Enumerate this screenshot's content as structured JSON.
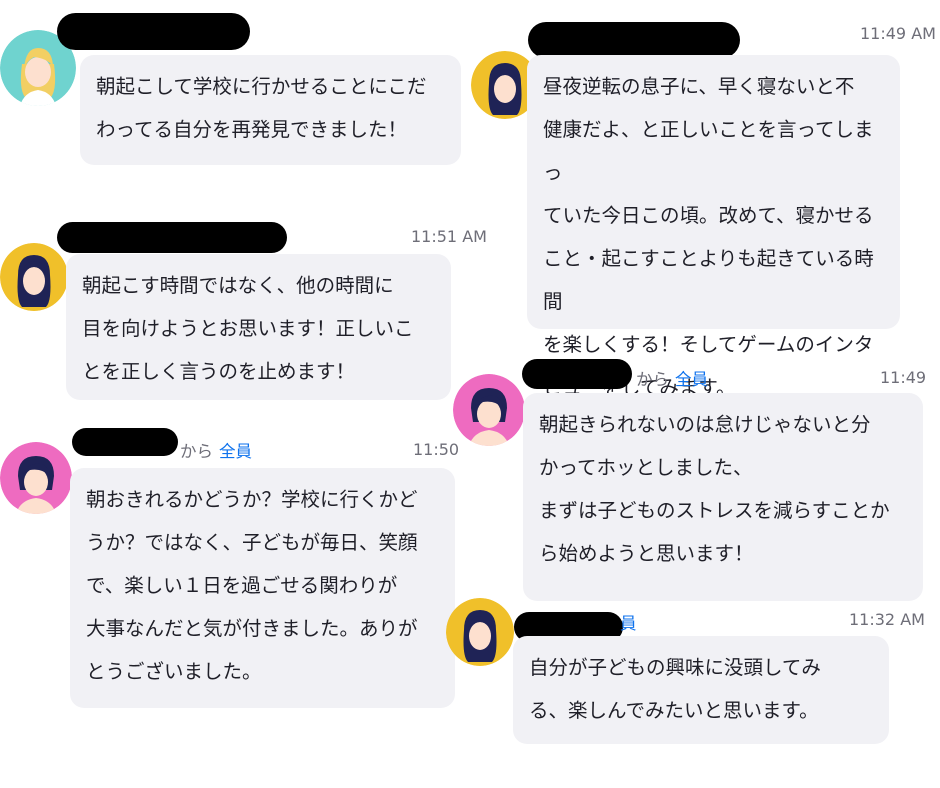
{
  "messages": [
    {
      "id": "m1",
      "time": "",
      "text": "朝起こして学校に行かせることにこだ\nわってる自分を再発見できました！",
      "avatar": "blonde-woman-avatar-icon"
    },
    {
      "id": "m2",
      "time": "11:51 AM",
      "text": "朝起こす時間ではなく、他の時間に\n目を向けようとお思います！正しいこ\nとを正しく言うのを止めます！",
      "avatar": "dark-haired-woman-avatar-icon"
    },
    {
      "id": "m3",
      "time": "11:50",
      "from_suffix": "から",
      "to": "全員",
      "text": "朝おきれるかどうか？学校に行くかど\nうか？ではなく、子どもが毎日、笑顔\nで、楽しい１日を過ごせる関わりが\n大事なんだと気が付きました。ありが\nとうございました。",
      "avatar": "woman-pink-avatar-icon"
    },
    {
      "id": "m4",
      "time": "11:49 AM",
      "text": "昼夜逆転の息子に、早く寝ないと不\n健康だよ、と正しいことを言ってしまっ\nていた今日この頃。改めて、寝かせる\nこと・起こすことよりも起きている時間\nを楽しくする！そしてゲームのインタ\nビューをしてみます。",
      "avatar": "dark-haired-woman-avatar-icon"
    },
    {
      "id": "m5",
      "time": "11:49",
      "from_suffix": "から",
      "to": "全員",
      "text": "朝起きられないのは怠けじゃないと分\nかってホッとしました、\nまずは子どものストレスを減らすことか\nら始めようと思います！",
      "avatar": "woman-pink-avatar-icon"
    },
    {
      "id": "m6",
      "time": "11:32 AM",
      "to": "員",
      "text": "自分が子どもの興味に没頭してみ\nる、楽しんでみたいと思います。",
      "avatar": "dark-haired-woman-avatar-icon"
    }
  ],
  "colors": {
    "bubble": "#f1f1f5",
    "link_blue": "#0e72ed",
    "avatar_yellow": "#f0c02a",
    "avatar_pink": "#ee6bc0",
    "avatar_teal": "#6fd3cf",
    "redaction": "#000000"
  }
}
